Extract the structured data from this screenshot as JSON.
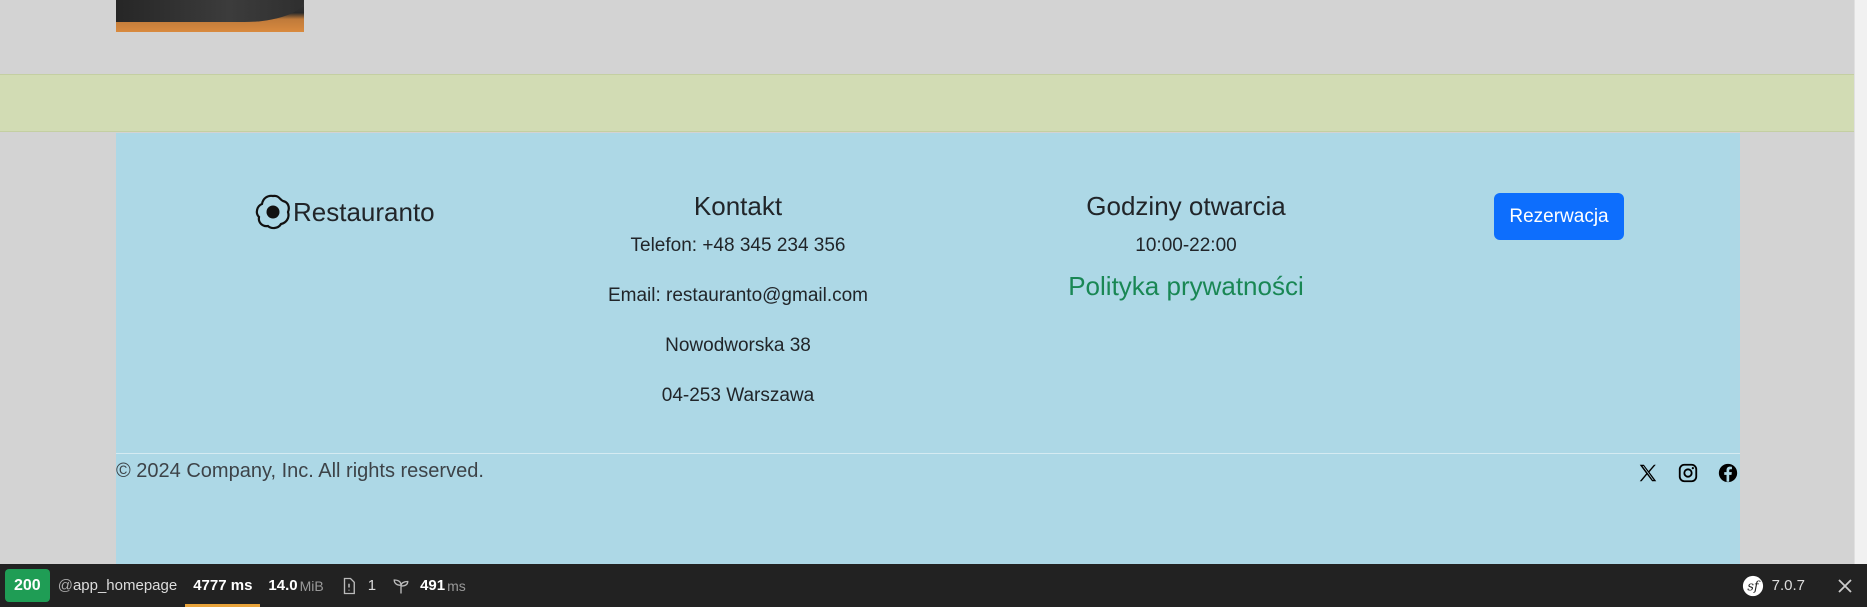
{
  "footer": {
    "brand": "Restauranto",
    "contact": {
      "heading": "Kontakt",
      "phone": "Telefon: +48 345 234 356",
      "email": "Email: restauranto@gmail.com",
      "street": "Nowodworska 38",
      "city": "04-253 Warszawa"
    },
    "hours": {
      "heading": "Godziny otwarcia",
      "value": "10:00-22:00",
      "privacy_link": "Polityka prywatności"
    },
    "reservation_button": "Rezerwacja",
    "copyright": "© 2024 Company, Inc. All rights reserved.",
    "socials": [
      "x-icon",
      "instagram-icon",
      "facebook-icon"
    ]
  },
  "debug_toolbar": {
    "status": "200",
    "route_prefix": "@",
    "route": "app_homepage",
    "time": "4777 ms",
    "memory_value": "14.0",
    "memory_unit": "MiB",
    "logs_count": "1",
    "twig_value": "491",
    "twig_unit": "ms",
    "version": "7.0.7"
  },
  "colors": {
    "footer_bg": "#add8e6",
    "band_bg": "#d2dcb4",
    "button_bg": "#0d6efd",
    "privacy_link": "#198754",
    "status_ok": "#1f9d55"
  }
}
